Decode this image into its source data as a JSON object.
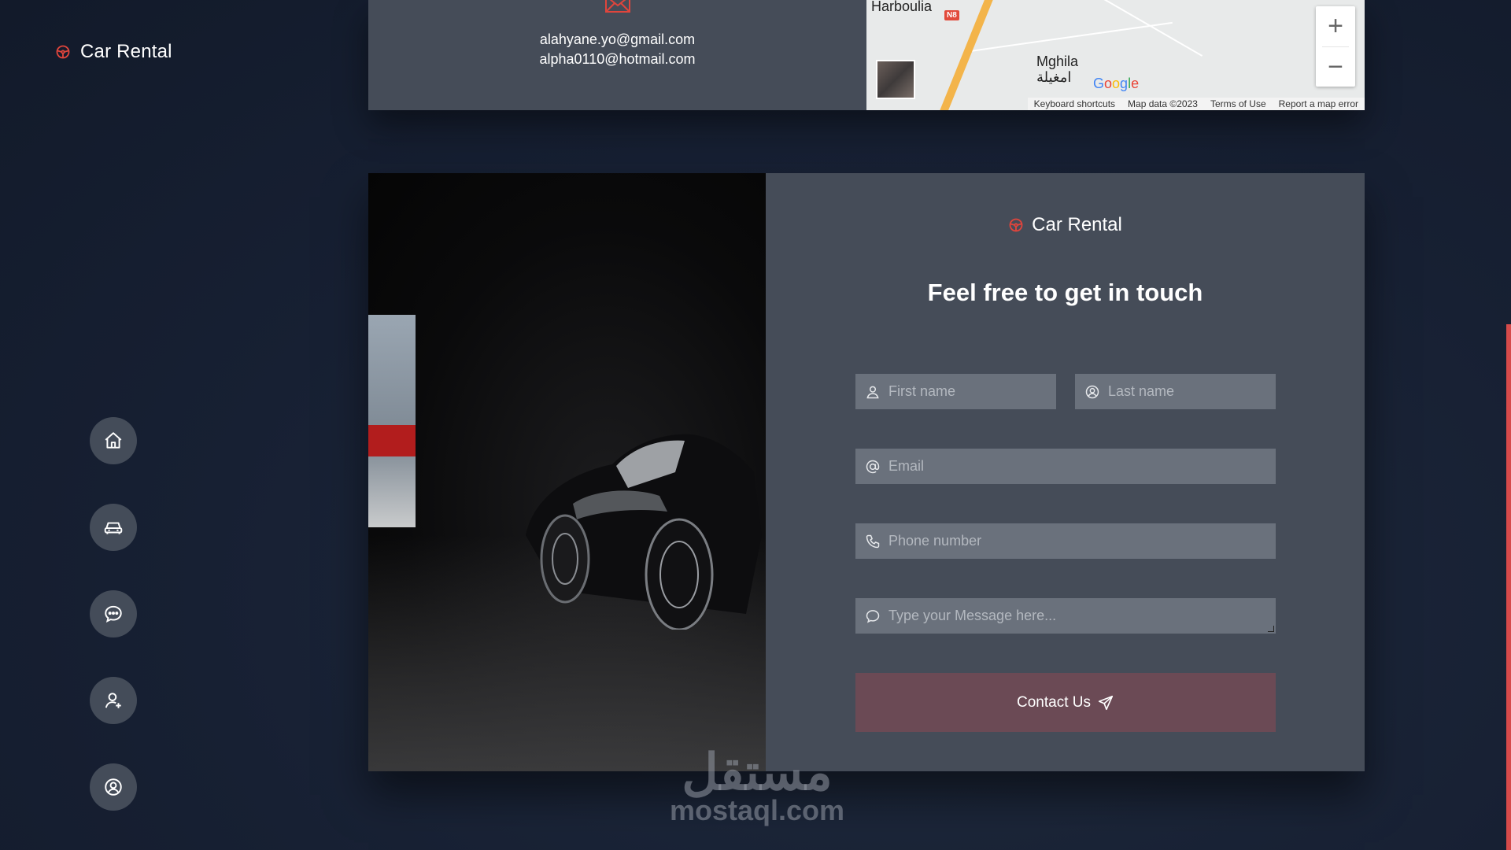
{
  "brand": {
    "name": "Car Rental",
    "accent": "#e0453c"
  },
  "nav": {
    "items": [
      {
        "name": "home",
        "icon": "home-icon"
      },
      {
        "name": "cars",
        "icon": "car-icon"
      },
      {
        "name": "messages",
        "icon": "chat-icon"
      },
      {
        "name": "add-user",
        "icon": "user-plus-icon"
      },
      {
        "name": "profile",
        "icon": "user-circle-icon"
      }
    ]
  },
  "contact_info": {
    "emails": [
      "alahyane.yo@gmail.com",
      "alpha0110@hotmail.com"
    ],
    "mail_icon": "mail-icon"
  },
  "map": {
    "places": {
      "harboulia": "Harboulia",
      "mghila": "Mghila",
      "mghila_ar": "امغيلة"
    },
    "road_badge": "N8",
    "logo": "Google",
    "zoom_in": "+",
    "zoom_out": "−",
    "footer": {
      "shortcuts": "Keyboard shortcuts",
      "data": "Map data ©2023",
      "terms": "Terms of Use",
      "report": "Report a map error"
    }
  },
  "form": {
    "brand": "Car Rental",
    "title": "Feel free to get in touch",
    "first_name_placeholder": "First name",
    "last_name_placeholder": "Last name",
    "email_placeholder": "Email",
    "phone_placeholder": "Phone number",
    "message_placeholder": "Type your Message here...",
    "submit_label": "Contact Us"
  },
  "watermark": {
    "arabic": "مستقل",
    "latin": "mostaql.com"
  },
  "colors": {
    "background": "#172033",
    "card": "#454c58",
    "field": "#6a717c",
    "submit": "#6b4a55",
    "scroll_accent": "#d64a4a"
  }
}
